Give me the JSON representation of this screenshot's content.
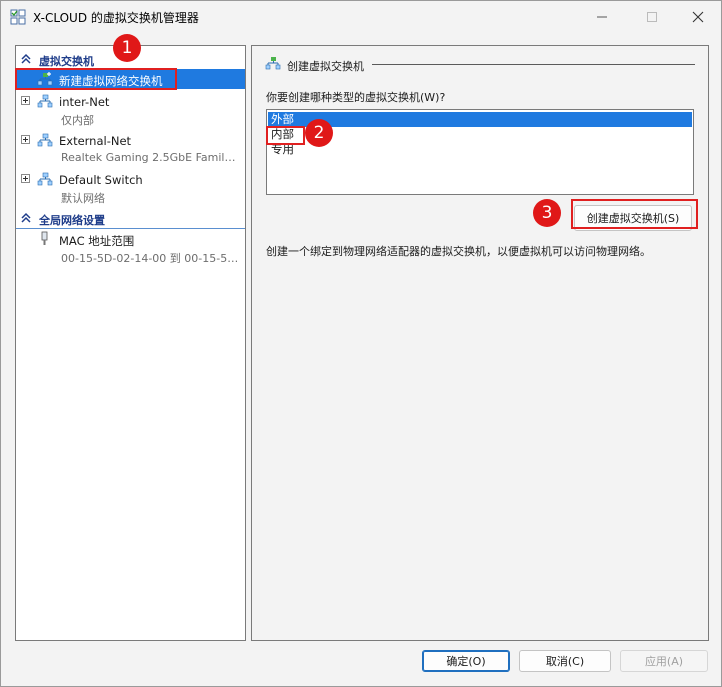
{
  "window": {
    "title": "X-CLOUD 的虚拟交换机管理器"
  },
  "left_pane": {
    "sections": [
      {
        "label": "虚拟交换机"
      },
      {
        "label": "全局网络设置"
      }
    ],
    "items": [
      {
        "label": "新建虚拟网络交换机",
        "sub": ""
      },
      {
        "label": "inter-Net",
        "sub": "仅内部"
      },
      {
        "label": "External-Net",
        "sub": "Realtek Gaming 2.5GbE Family C..."
      },
      {
        "label": "Default Switch",
        "sub": "默认网络"
      },
      {
        "label": "MAC 地址范围",
        "sub": "00-15-5D-02-14-00 到 00-15-5D-..."
      }
    ]
  },
  "right_pane": {
    "heading": "创建虚拟交换机",
    "question": "你要创建哪种类型的虚拟交换机(W)?",
    "options": [
      "外部",
      "内部",
      "专用"
    ],
    "selected_option": "外部",
    "create_button": "创建虚拟交换机(S)",
    "description": "创建一个绑定到物理网络适配器的虚拟交换机，以便虚拟机可以访问物理网络。"
  },
  "footer": {
    "ok": "确定(O)",
    "cancel": "取消(C)",
    "apply": "应用(A)"
  },
  "annotations": [
    "1",
    "2",
    "3"
  ],
  "colors": {
    "selection": "#1f7ae0",
    "section_header": "#1f3d8a",
    "annotation": "#e01818"
  }
}
